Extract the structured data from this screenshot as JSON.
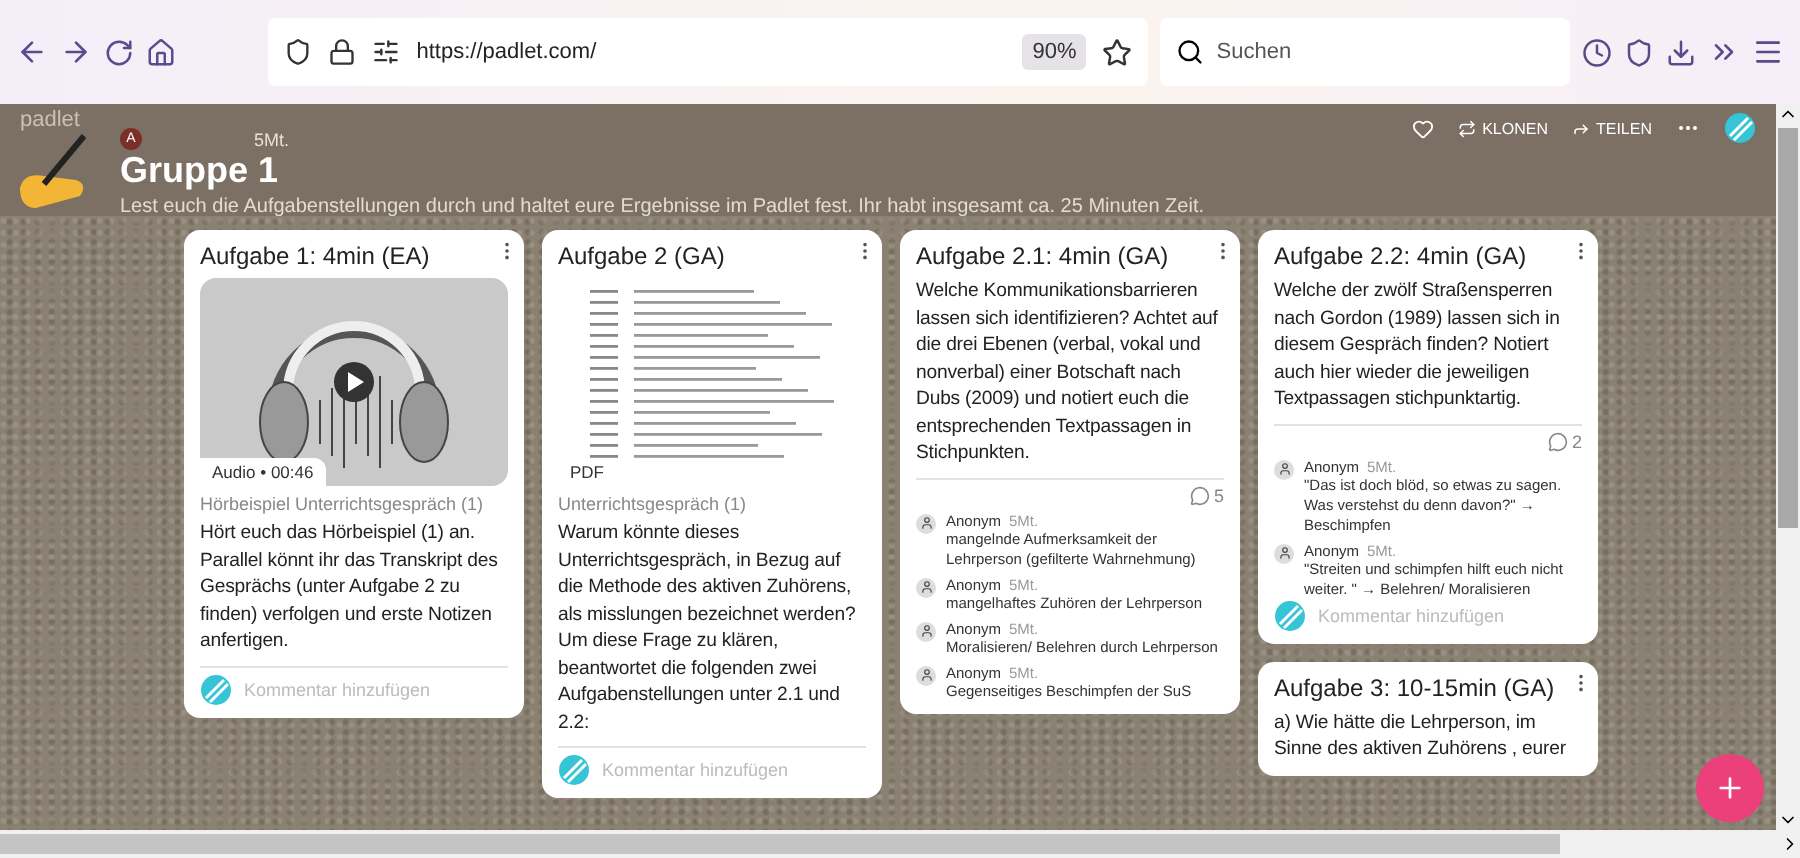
{
  "browser": {
    "url": "https://padlet.com/",
    "zoom": "90%",
    "search_placeholder": "Suchen"
  },
  "header": {
    "brand": "padlet",
    "actions": [
      {
        "kind": "clone",
        "label": "KLONEN"
      },
      {
        "kind": "share",
        "label": "TEILEN"
      }
    ],
    "author_initial": "A",
    "time": "5Mt.",
    "title": "Gruppe 1",
    "description": "Lest euch die Aufgabenstellungen durch und haltet eure Ergebnisse im Padlet fest. Ihr habt insgesamt ca. 25 Minuten Zeit."
  },
  "columns": [
    [
      {
        "title": "Aufgabe 1: 4min (EA)",
        "attachment": {
          "kind": "audio",
          "caption": "Audio • 00:46"
        },
        "attachment_title": "Hörbeispiel Unterrichtsgespräch (1)",
        "body": "Hört euch das Hörbeispiel (1) an. Parallel könnt ihr das Transkript des Gesprächs (unter Aufgabe 2 zu finden) verfolgen und erste Notizen anfertigen.",
        "comment_placeholder": "Kommentar hinzufügen"
      }
    ],
    [
      {
        "title": "Aufgabe 2 (GA)",
        "attachment": {
          "kind": "pdf",
          "caption": "PDF"
        },
        "attachment_title": "Unterrichtsgespräch (1)",
        "body": "Warum könnte dieses Unterrichtsgespräch, in Bezug auf die Methode des aktiven Zuhörens, als misslungen bezeichnet werden? Um diese Frage zu klären, beantwortet die folgenden zwei Aufgabenstellungen unter 2.1 und 2.2:",
        "comment_placeholder": "Kommentar hinzufügen"
      }
    ],
    [
      {
        "title": "Aufgabe 2.1: 4min (GA)",
        "body": "Welche Kommunikationsbarrieren lassen sich identifizieren? Achtet auf die drei Ebenen (verbal, vokal und nonverbal) einer Botschaft nach Dubs (2009) und notiert euch die entsprechenden Textpassagen in Stichpunkten.",
        "comment_count": "5",
        "comments": [
          {
            "author": "Anonym",
            "time": "5Mt.",
            "text": "mangelnde Aufmerksamkeit der Lehrperson (gefilterte Wahrnehmung)"
          },
          {
            "author": "Anonym",
            "time": "5Mt.",
            "text": "mangelhaftes Zuhören der Lehrperson"
          },
          {
            "author": "Anonym",
            "time": "5Mt.",
            "text": "Moralisieren/ Belehren durch Lehrperson"
          },
          {
            "author": "Anonym",
            "time": "5Mt.",
            "text": "Gegenseitiges Beschimpfen der SuS"
          }
        ]
      }
    ],
    [
      {
        "title": "Aufgabe 2.2: 4min (GA)",
        "body": "Welche der zwölf Straßensperren nach Gordon (1989) lassen sich in diesem Gespräch finden? Notiert auch hier wieder die jeweiligen Textpassagen stichpunktartig.",
        "comment_count": "2",
        "comments": [
          {
            "author": "Anonym",
            "time": "5Mt.",
            "text": "\"Das ist doch blöd, so etwas zu sagen. Was verstehst du denn davon?\" → Beschimpfen"
          },
          {
            "author": "Anonym",
            "time": "5Mt.",
            "text": "\"Streiten und schimpfen hilft euch nicht weiter. \" → Belehren/ Moralisieren"
          }
        ],
        "comment_placeholder": "Kommentar hinzufügen"
      },
      {
        "title": "Aufgabe 3: 10-15min (GA)",
        "body": "a) Wie hätte die Lehrperson, im Sinne des aktiven Zuhörens , eurer"
      }
    ]
  ]
}
